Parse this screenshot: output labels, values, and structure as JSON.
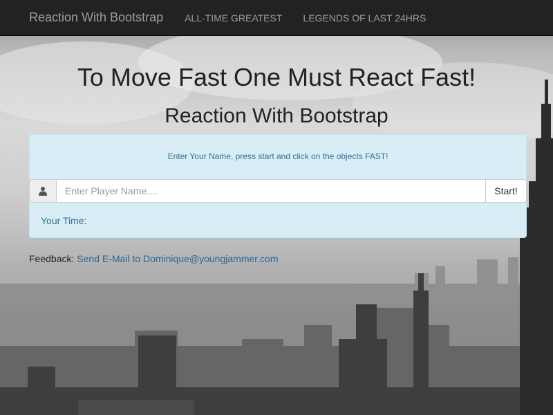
{
  "navbar": {
    "brand": "Reaction With Bootstrap",
    "links": [
      {
        "label": "ALL-TIME GREATEST"
      },
      {
        "label": "LEGENDS OF LAST 24HRS"
      }
    ]
  },
  "main": {
    "title": "To Move Fast One Must React Fast!",
    "subtitle": "Reaction With Bootstrap",
    "instruction": "Enter Your Name, press start and click on the objects FAST!",
    "player_input": {
      "value": "",
      "placeholder": "Enter Player Name...."
    },
    "start_label": "Start!",
    "your_time_label": "Your Time:",
    "your_time_value": ""
  },
  "feedback": {
    "label": "Feedback:",
    "link_text": "Send E-Mail to Dominique@youngjammer.com"
  },
  "icons": {
    "input_addon": "user-icon"
  },
  "colors": {
    "navbar_bg": "#222222",
    "nav_text": "#9d9d9d",
    "well_bg": "#d9edf7",
    "info_text": "#31708f",
    "link": "#2a6496"
  }
}
